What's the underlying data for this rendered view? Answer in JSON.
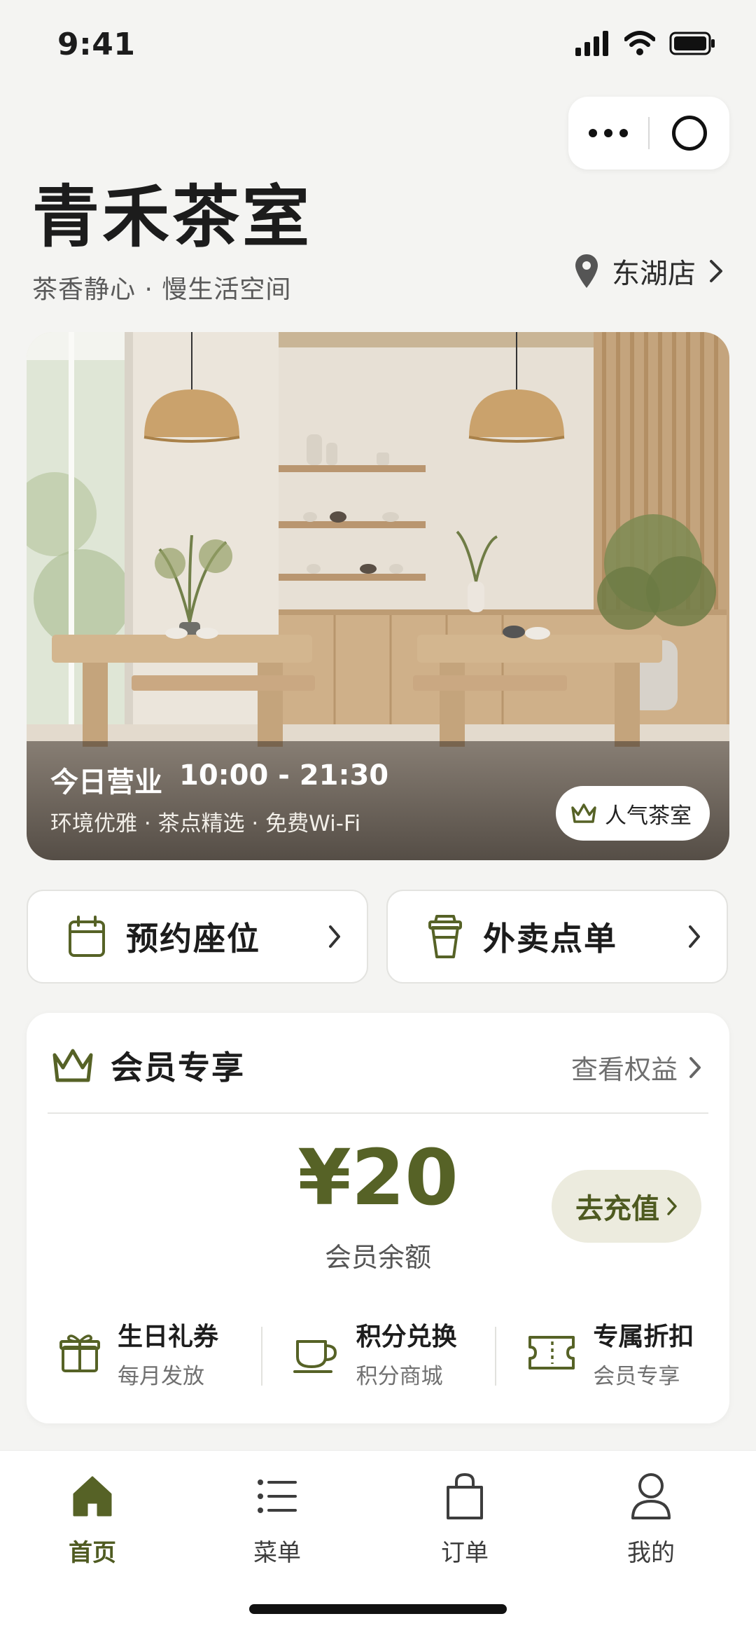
{
  "status_bar": {
    "time": "9:41"
  },
  "header": {
    "store_name": "青禾茶室",
    "tagline": "茶香静心 · 慢生活空间",
    "branch": "东湖店"
  },
  "hero": {
    "hours_label": "今日营业",
    "hours": "10:00 - 21:30",
    "features": "环境优雅 · 茶点精选 · 免费Wi-Fi",
    "badge": "人气茶室"
  },
  "actions": [
    {
      "label": "预约座位",
      "icon": "calendar-icon"
    },
    {
      "label": "外卖点单",
      "icon": "takeaway-cup-icon"
    }
  ],
  "member": {
    "title": "会员专享",
    "rights_link": "查看权益",
    "balance": "¥20",
    "balance_label": "会员余额",
    "recharge": "去充值",
    "benefits": [
      {
        "title": "生日礼券",
        "subtitle": "每月发放",
        "icon": "gift-icon"
      },
      {
        "title": "积分兑换",
        "subtitle": "积分商城",
        "icon": "cup-icon"
      },
      {
        "title": "专属折扣",
        "subtitle": "会员专享",
        "icon": "ticket-icon"
      }
    ]
  },
  "tabbar": {
    "items": [
      {
        "label": "首页",
        "icon": "home-icon",
        "active": true
      },
      {
        "label": "菜单",
        "icon": "list-icon",
        "active": false
      },
      {
        "label": "订单",
        "icon": "bag-icon",
        "active": false
      },
      {
        "label": "我的",
        "icon": "user-icon",
        "active": false
      }
    ]
  },
  "colors": {
    "accent": "#566226",
    "background": "#f4f4f2",
    "recharge_bg": "#ecebde"
  }
}
